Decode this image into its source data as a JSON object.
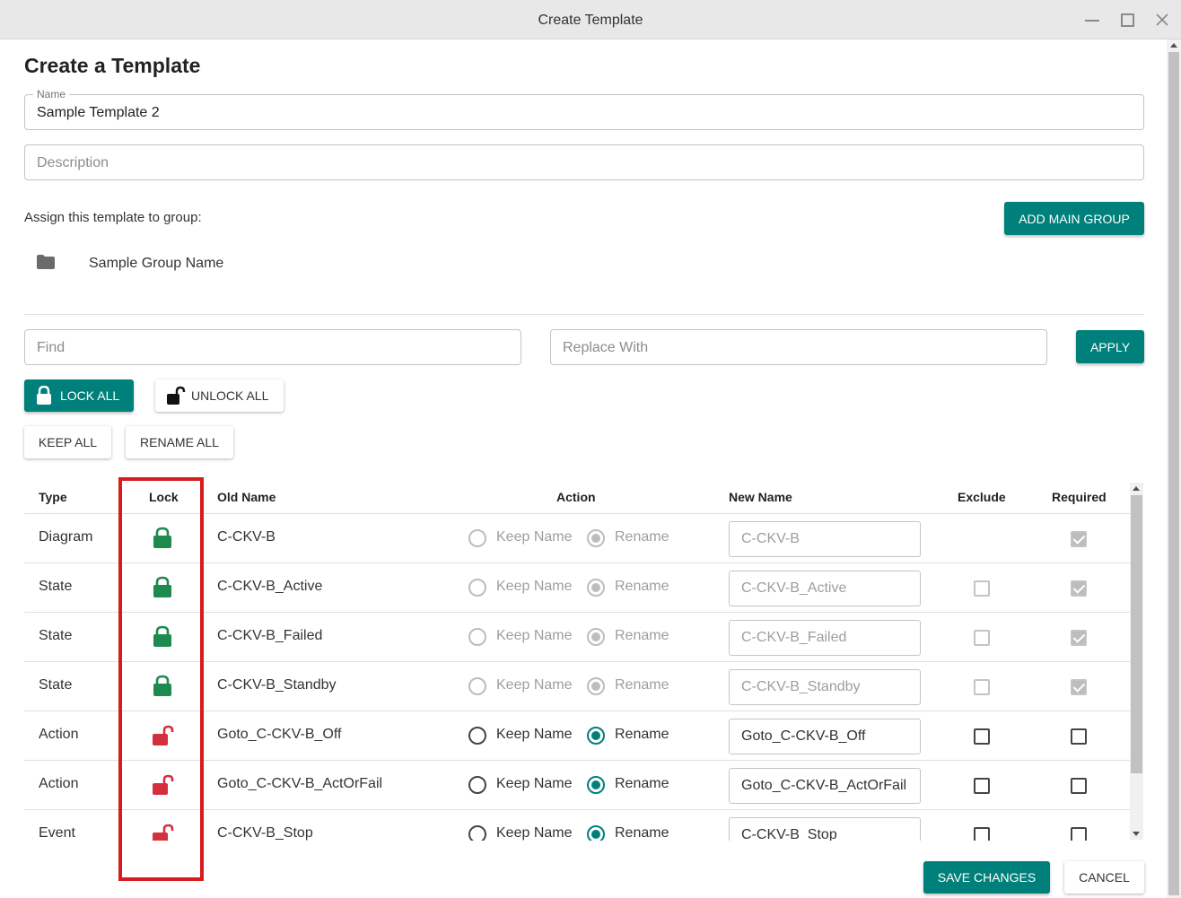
{
  "window": {
    "title": "Create Template",
    "controls": [
      "minimize-icon",
      "maximize-icon",
      "close-icon"
    ]
  },
  "heading": "Create a Template",
  "name_field": {
    "label": "Name",
    "value": "Sample Template 2"
  },
  "description_field": {
    "placeholder": "Description"
  },
  "assign": {
    "label": "Assign this template to group:",
    "add_button": "ADD MAIN GROUP",
    "group_name": "Sample Group Name",
    "group_icon": "folder-icon"
  },
  "find_field": {
    "placeholder": "Find"
  },
  "replace_field": {
    "placeholder": "Replace With"
  },
  "apply_button": "APPLY",
  "lock_all_button": "LOCK ALL",
  "unlock_all_button": "UNLOCK ALL",
  "keep_all_button": "KEEP ALL",
  "rename_all_button": "RENAME ALL",
  "table": {
    "headers": {
      "type": "Type",
      "lock": "Lock",
      "old_name": "Old Name",
      "action": "Action",
      "new_name": "New Name",
      "exclude": "Exclude",
      "required": "Required"
    },
    "keep_label": "Keep Name",
    "rename_label": "Rename",
    "rows": [
      {
        "type": "Diagram",
        "locked": true,
        "old_name": "C-CKV-B",
        "action": "Rename",
        "new_name": "C-CKV-B",
        "exclude": null,
        "required": true
      },
      {
        "type": "State",
        "locked": true,
        "old_name": "C-CKV-B_Active",
        "action": "Rename",
        "new_name": "C-CKV-B_Active",
        "exclude": false,
        "required": true
      },
      {
        "type": "State",
        "locked": true,
        "old_name": "C-CKV-B_Failed",
        "action": "Rename",
        "new_name": "C-CKV-B_Failed",
        "exclude": false,
        "required": true
      },
      {
        "type": "State",
        "locked": true,
        "old_name": "C-CKV-B_Standby",
        "action": "Rename",
        "new_name": "C-CKV-B_Standby",
        "exclude": false,
        "required": true
      },
      {
        "type": "Action",
        "locked": false,
        "old_name": "Goto_C-CKV-B_Off",
        "action": "Rename",
        "new_name": "Goto_C-CKV-B_Off",
        "exclude": false,
        "required": false
      },
      {
        "type": "Action",
        "locked": false,
        "old_name": "Goto_C-CKV-B_ActOrFail",
        "action": "Rename",
        "new_name": "Goto_C-CKV-B_ActOrFail",
        "exclude": false,
        "required": false
      },
      {
        "type": "Event",
        "locked": false,
        "old_name": "C-CKV-B_Stop",
        "action": "Rename",
        "new_name": "C-CKV-B_Stop",
        "exclude": false,
        "required": false
      }
    ]
  },
  "save_button": "SAVE CHANGES",
  "cancel_button": "CANCEL",
  "colors": {
    "teal": "#00807a",
    "lock_green": "#1e8a4e",
    "unlock_red": "#d32f3f",
    "highlight": "#d71c1c"
  }
}
